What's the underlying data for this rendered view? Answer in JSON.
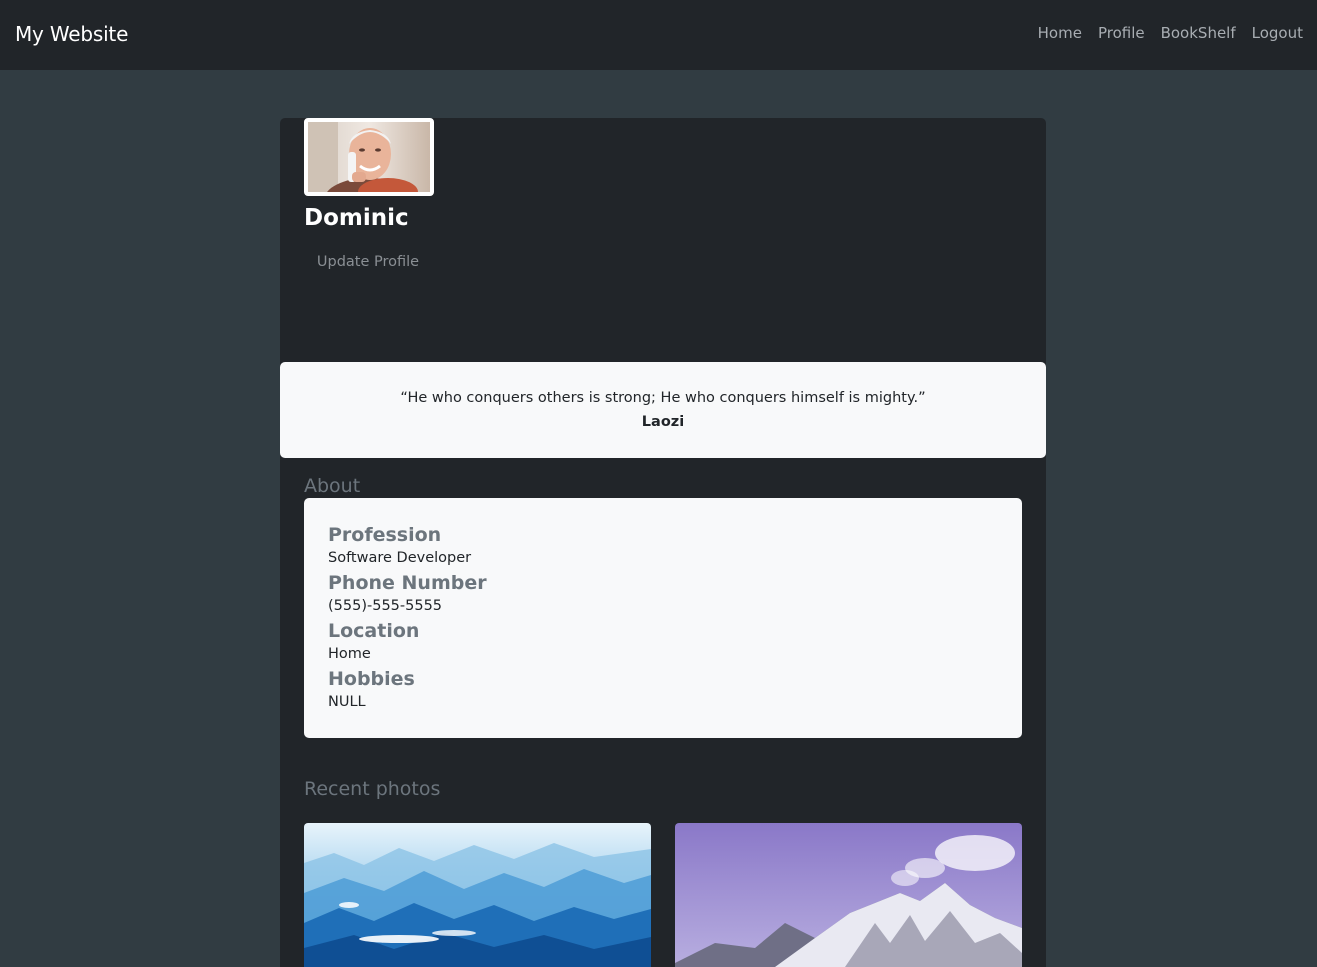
{
  "navbar": {
    "brand": "My Website",
    "links": [
      "Home",
      "Profile",
      "BookShelf",
      "Logout"
    ]
  },
  "profile": {
    "name": "Dominic",
    "update_label": "Update Profile"
  },
  "quote": {
    "text": "“He who conquers others is strong; He who conquers himself is mighty.”",
    "author": "Laozi"
  },
  "about": {
    "title": "About",
    "items": [
      {
        "label": "Profession",
        "value": "Software Developer"
      },
      {
        "label": "Phone Number",
        "value": "(555)-555-5555"
      },
      {
        "label": "Location",
        "value": "Home"
      },
      {
        "label": "Hobbies",
        "value": "NULL"
      }
    ]
  },
  "photos": {
    "title": "Recent photos"
  },
  "colors": {
    "page_bg": "#313c42",
    "navbar_bg": "#212529",
    "card_bg": "#212529",
    "panel_bg": "#f8f9fa",
    "muted": "#6c757d"
  }
}
